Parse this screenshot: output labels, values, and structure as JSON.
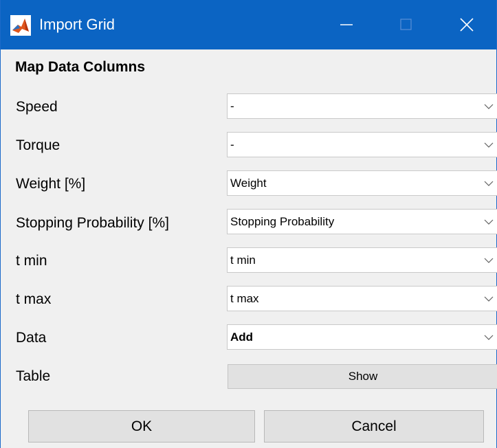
{
  "window": {
    "title": "Import Grid",
    "icon": "matlab-icon",
    "controls": {
      "minimize": "minimize-icon",
      "maximize": "maximize-icon",
      "close": "close-icon"
    },
    "titlebar_color": "#0b64c3"
  },
  "section": {
    "title": "Map Data Columns"
  },
  "rows": [
    {
      "label": "Speed",
      "value": "-"
    },
    {
      "label": "Torque",
      "value": "-"
    },
    {
      "label": "Weight [%]",
      "value": "Weight"
    },
    {
      "label": "Stopping Probability [%]",
      "value": "Stopping Probability"
    },
    {
      "label": "t min",
      "value": "t min"
    },
    {
      "label": "t max",
      "value": "t max"
    },
    {
      "label": "Data",
      "value": "Add"
    }
  ],
  "table": {
    "label": "Table",
    "button": "Show"
  },
  "buttons": {
    "ok": "OK",
    "cancel": "Cancel"
  }
}
